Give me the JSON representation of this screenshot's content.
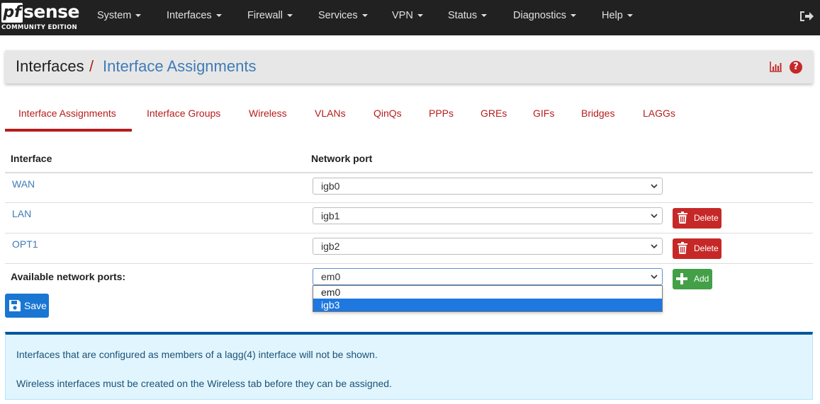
{
  "brand": {
    "logo_pf": "pf",
    "logo_sense": "sense",
    "edition": "COMMUNITY EDITION"
  },
  "nav": [
    {
      "label": "System"
    },
    {
      "label": "Interfaces"
    },
    {
      "label": "Firewall"
    },
    {
      "label": "Services"
    },
    {
      "label": "VPN"
    },
    {
      "label": "Status"
    },
    {
      "label": "Diagnostics"
    },
    {
      "label": "Help"
    }
  ],
  "breadcrumb": {
    "parent": "Interfaces",
    "separator": "/",
    "current": "Interface Assignments"
  },
  "tabs": [
    {
      "label": "Interface Assignments",
      "active": true
    },
    {
      "label": "Interface Groups"
    },
    {
      "label": "Wireless"
    },
    {
      "label": "VLANs"
    },
    {
      "label": "QinQs"
    },
    {
      "label": "PPPs"
    },
    {
      "label": "GREs"
    },
    {
      "label": "GIFs"
    },
    {
      "label": "Bridges"
    },
    {
      "label": "LAGGs"
    }
  ],
  "table": {
    "headers": {
      "interface": "Interface",
      "port": "Network port"
    },
    "rows": [
      {
        "name": "WAN",
        "port": "igb0"
      },
      {
        "name": "LAN",
        "port": "igb1",
        "action": "Delete"
      },
      {
        "name": "OPT1",
        "port": "igb2",
        "action": "Delete"
      }
    ],
    "available_label": "Available network ports:",
    "available_selected": "em0",
    "available_options": [
      "em0",
      "igb3"
    ],
    "highlighted_option": "igb3",
    "add_label": "Add"
  },
  "save_label": "Save",
  "info": [
    "Interfaces that are configured as members of a lagg(4) interface will not be shown.",
    "Wireless interfaces must be created on the Wireless tab before they can be assigned."
  ],
  "colors": {
    "navbar": "#212121",
    "accent_red": "#b71c1c",
    "link_blue": "#3f7bb7",
    "save_blue": "#1976d2",
    "add_green": "#43a047",
    "info_bg": "#e1f5fe"
  },
  "icons": {
    "logout": "logout-icon",
    "chart": "bar-chart-icon",
    "help": "help-icon",
    "trash": "trash-icon",
    "plus": "plus-icon",
    "save": "floppy-disk-icon"
  }
}
